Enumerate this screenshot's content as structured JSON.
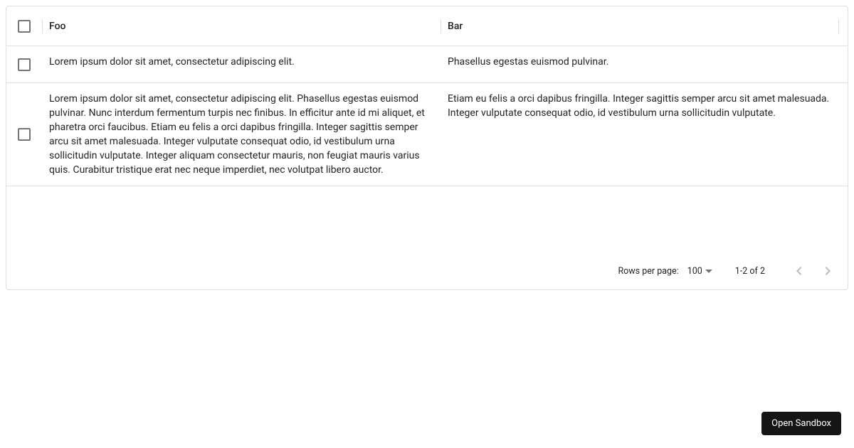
{
  "columns": {
    "foo": "Foo",
    "bar": "Bar"
  },
  "rows": [
    {
      "foo": "Lorem ipsum dolor sit amet, consectetur adipiscing elit.",
      "bar": "Phasellus egestas euismod pulvinar."
    },
    {
      "foo": "Lorem ipsum dolor sit amet, consectetur adipiscing elit. Phasellus egestas euismod pulvinar. Nunc interdum fermentum turpis nec finibus. In efficitur ante id mi aliquet, et pharetra orci faucibus. Etiam eu felis a orci dapibus fringilla. Integer sagittis semper arcu sit amet malesuada. Integer vulputate consequat odio, id vestibulum urna sollicitudin vulputate. Integer aliquam consectetur mauris, non feugiat mauris varius quis. Curabitur tristique erat nec neque imperdiet, nec volutpat libero auctor.",
      "bar": "Etiam eu felis a orci dapibus fringilla. Integer sagittis semper arcu sit amet malesuada. Integer vulputate consequat odio, id vestibulum urna sollicitudin vulputate."
    }
  ],
  "footer": {
    "rows_per_page_label": "Rows per page:",
    "rows_per_page_value": "100",
    "range": "1-2 of 2"
  },
  "sandbox_button": "Open Sandbox"
}
